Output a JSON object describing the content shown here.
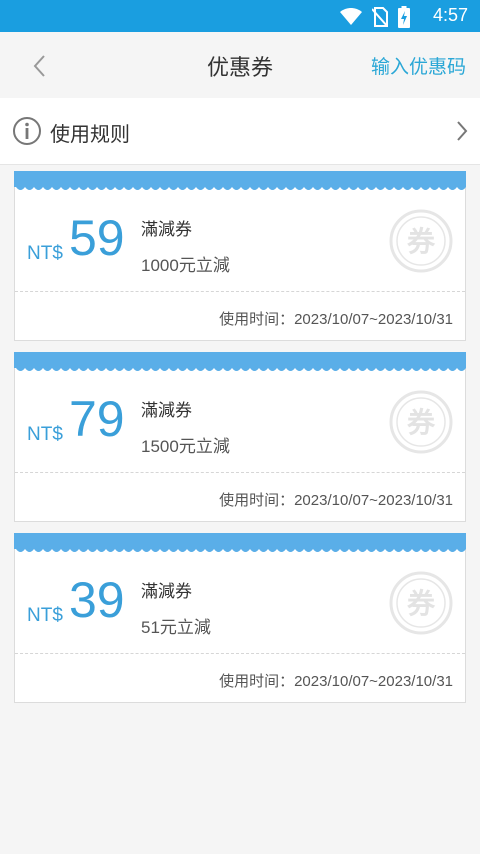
{
  "status_bar": {
    "time": "4:57"
  },
  "header": {
    "title": "优惠券",
    "action_label": "输入优惠码"
  },
  "rules": {
    "label": "使用规则"
  },
  "coupons": [
    {
      "currency": "NT$",
      "amount": "59",
      "type": "滿減券",
      "desc": "1000元立減",
      "date_label": "使用时间：",
      "date_range": "2023/10/07~2023/10/31",
      "stamp": "券"
    },
    {
      "currency": "NT$",
      "amount": "79",
      "type": "滿減券",
      "desc": "1500元立減",
      "date_label": "使用时间：",
      "date_range": "2023/10/07~2023/10/31",
      "stamp": "券"
    },
    {
      "currency": "NT$",
      "amount": "39",
      "type": "滿減券",
      "desc": "51元立減",
      "date_label": "使用时间：",
      "date_range": "2023/10/07~2023/10/31",
      "stamp": "券"
    }
  ],
  "colors": {
    "accent": "#3a9fd9",
    "status_bar": "#1a9ee0",
    "wave": "#5aaee8",
    "stamp": "#e6e6e6"
  },
  "icons": {
    "back": "chevron-left-icon",
    "info": "info-icon",
    "rules_chevron": "chevron-right-icon",
    "wifi": "wifi-icon",
    "no_sim": "no-sim-icon",
    "battery": "battery-charging-icon"
  }
}
